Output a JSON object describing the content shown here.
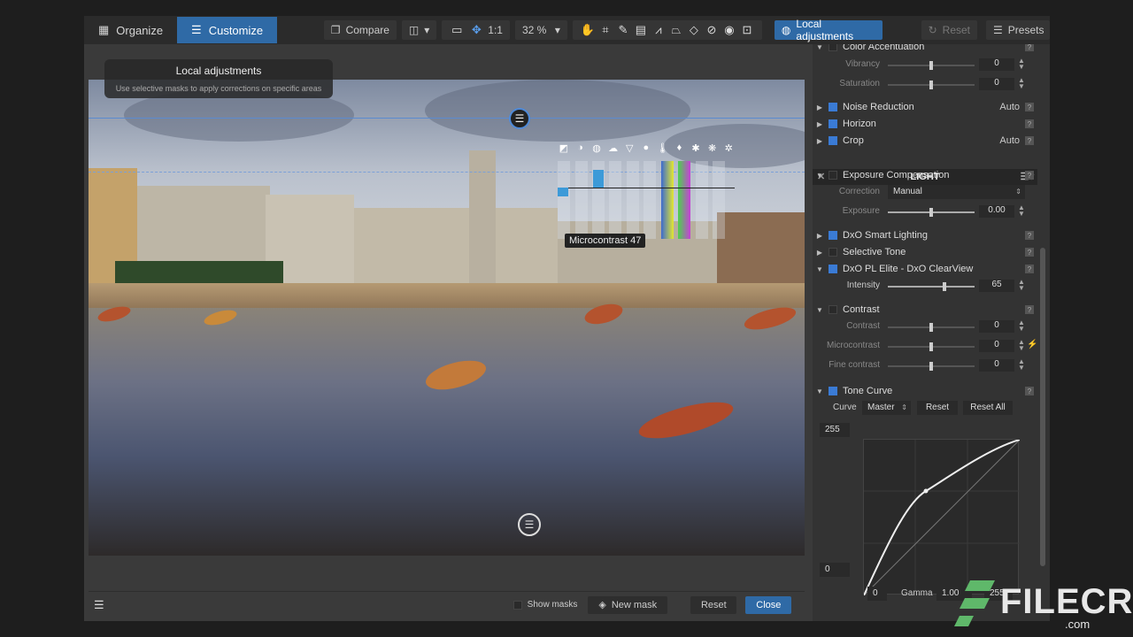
{
  "toolbar": {
    "tab_organize": "Organize",
    "tab_customize": "Customize",
    "compare": "Compare",
    "ratio": "1:1",
    "zoom": "32 %",
    "local_adjustments": "Local adjustments",
    "reset": "Reset",
    "presets": "Presets"
  },
  "tooltip": {
    "title": "Local adjustments",
    "subtitle": "Use selective masks to apply corrections on specific areas"
  },
  "overlay": {
    "microcontrast_label": "Microcontrast 47"
  },
  "bottom": {
    "show_masks": "Show masks",
    "new_mask": "New mask",
    "reset": "Reset",
    "close": "Close"
  },
  "panel": {
    "color_accentuation": "Color Accentuation",
    "vibrancy_label": "Vibrancy",
    "vibrancy_value": "0",
    "saturation_label": "Saturation",
    "saturation_value": "0",
    "noise_reduction": "Noise Reduction",
    "noise_reduction_value": "Auto",
    "horizon": "Horizon",
    "crop": "Crop",
    "crop_value": "Auto",
    "light_header": "LIGHT",
    "exposure_compensation": "Exposure Compensation",
    "correction_label": "Correction",
    "correction_value": "Manual",
    "exposure_label": "Exposure",
    "exposure_value": "0.00",
    "smart_lighting": "DxO Smart Lighting",
    "selective_tone": "Selective Tone",
    "clearview": "DxO PL Elite - DxO ClearView",
    "intensity_label": "Intensity",
    "intensity_value": "65",
    "contrast": "Contrast",
    "contrast_label": "Contrast",
    "contrast_value": "0",
    "microcontrast_label": "Microcontrast",
    "microcontrast_value": "0",
    "fine_contrast_label": "Fine contrast",
    "fine_contrast_value": "0",
    "tone_curve": "Tone Curve",
    "curve_label": "Curve",
    "curve_channel": "Master",
    "curve_reset": "Reset",
    "curve_reset_all": "Reset All",
    "curve_top_value": "255",
    "curve_bottom_value": "0",
    "curve_x_min": "0",
    "gamma_label": "Gamma",
    "gamma_value": "1.00",
    "curve_x_max": "255"
  },
  "watermark": {
    "brand": "FILECR",
    "domain": ".com"
  },
  "colors": {
    "accent_blue": "#2f6aa6",
    "panel_bg": "#333333",
    "toolbar_bg": "#2b2b2b"
  }
}
